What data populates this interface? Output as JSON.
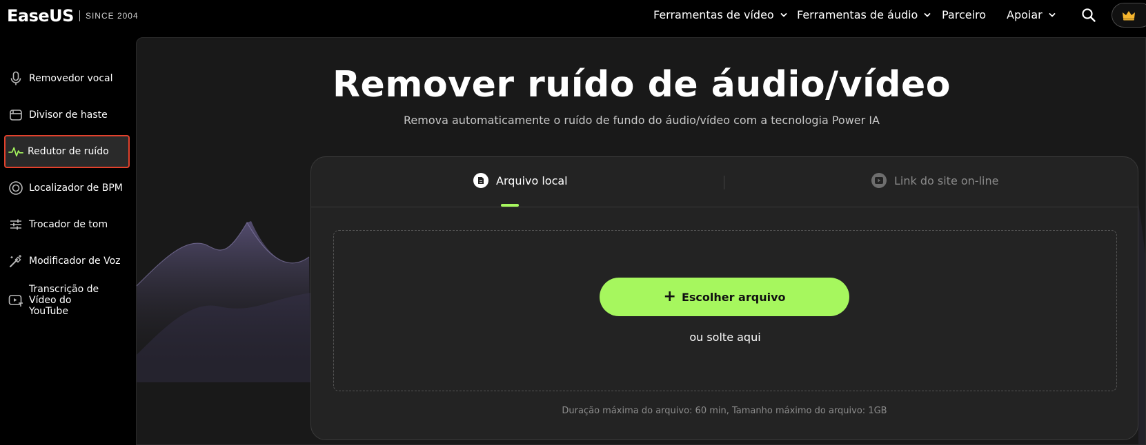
{
  "brand": {
    "logo_text": "EaseUS",
    "since_text": "SINCE 2004"
  },
  "nav": {
    "items": [
      {
        "label": "Ferramentas de vídeo",
        "has_dropdown": true
      },
      {
        "label": "Ferramentas de áudio",
        "has_dropdown": true
      },
      {
        "label": "Parceiro",
        "has_dropdown": false
      },
      {
        "label": "Apoiar",
        "has_dropdown": true
      }
    ],
    "search_icon": "search-icon",
    "premium_icon": "crown-icon"
  },
  "sidebar": {
    "items": [
      {
        "label": "Removedor vocal",
        "icon": "microphone-icon",
        "active": false
      },
      {
        "label": "Divisor de haste",
        "icon": "stem-split-icon",
        "active": false
      },
      {
        "label": "Redutor de ruído",
        "icon": "pulse-wave-icon",
        "active": true
      },
      {
        "label": "Localizador de BPM",
        "icon": "bpm-icon",
        "active": false
      },
      {
        "label": "Trocador de tom",
        "icon": "sliders-icon",
        "active": false
      },
      {
        "label": "Modificador de Voz",
        "icon": "magic-wand-icon",
        "active": false
      },
      {
        "label": "Transcrição de Vídeo do YouTube",
        "icon": "video-transcript-icon",
        "active": false
      }
    ]
  },
  "main": {
    "title": "Remover ruído de áudio/vídeo",
    "subtitle": "Remova automaticamente o ruído de fundo do áudio/vídeo com a tecnologia Power IA",
    "tabs": [
      {
        "label": "Arquivo local",
        "icon": "file-icon",
        "selected": true
      },
      {
        "label": "Link do site on-line",
        "icon": "play-link-icon",
        "selected": false
      }
    ],
    "upload": {
      "button_label": "Escolher arquivo",
      "drop_hint": "ou solte aqui",
      "limits": "Duração máxima do arquivo: 60 min, Tamanho máximo do arquivo: 1GB"
    }
  },
  "colors": {
    "accent": "#a6f75e",
    "active_outline": "#e2412c",
    "background": "#000000",
    "panel": "#191919",
    "card": "#232323"
  }
}
